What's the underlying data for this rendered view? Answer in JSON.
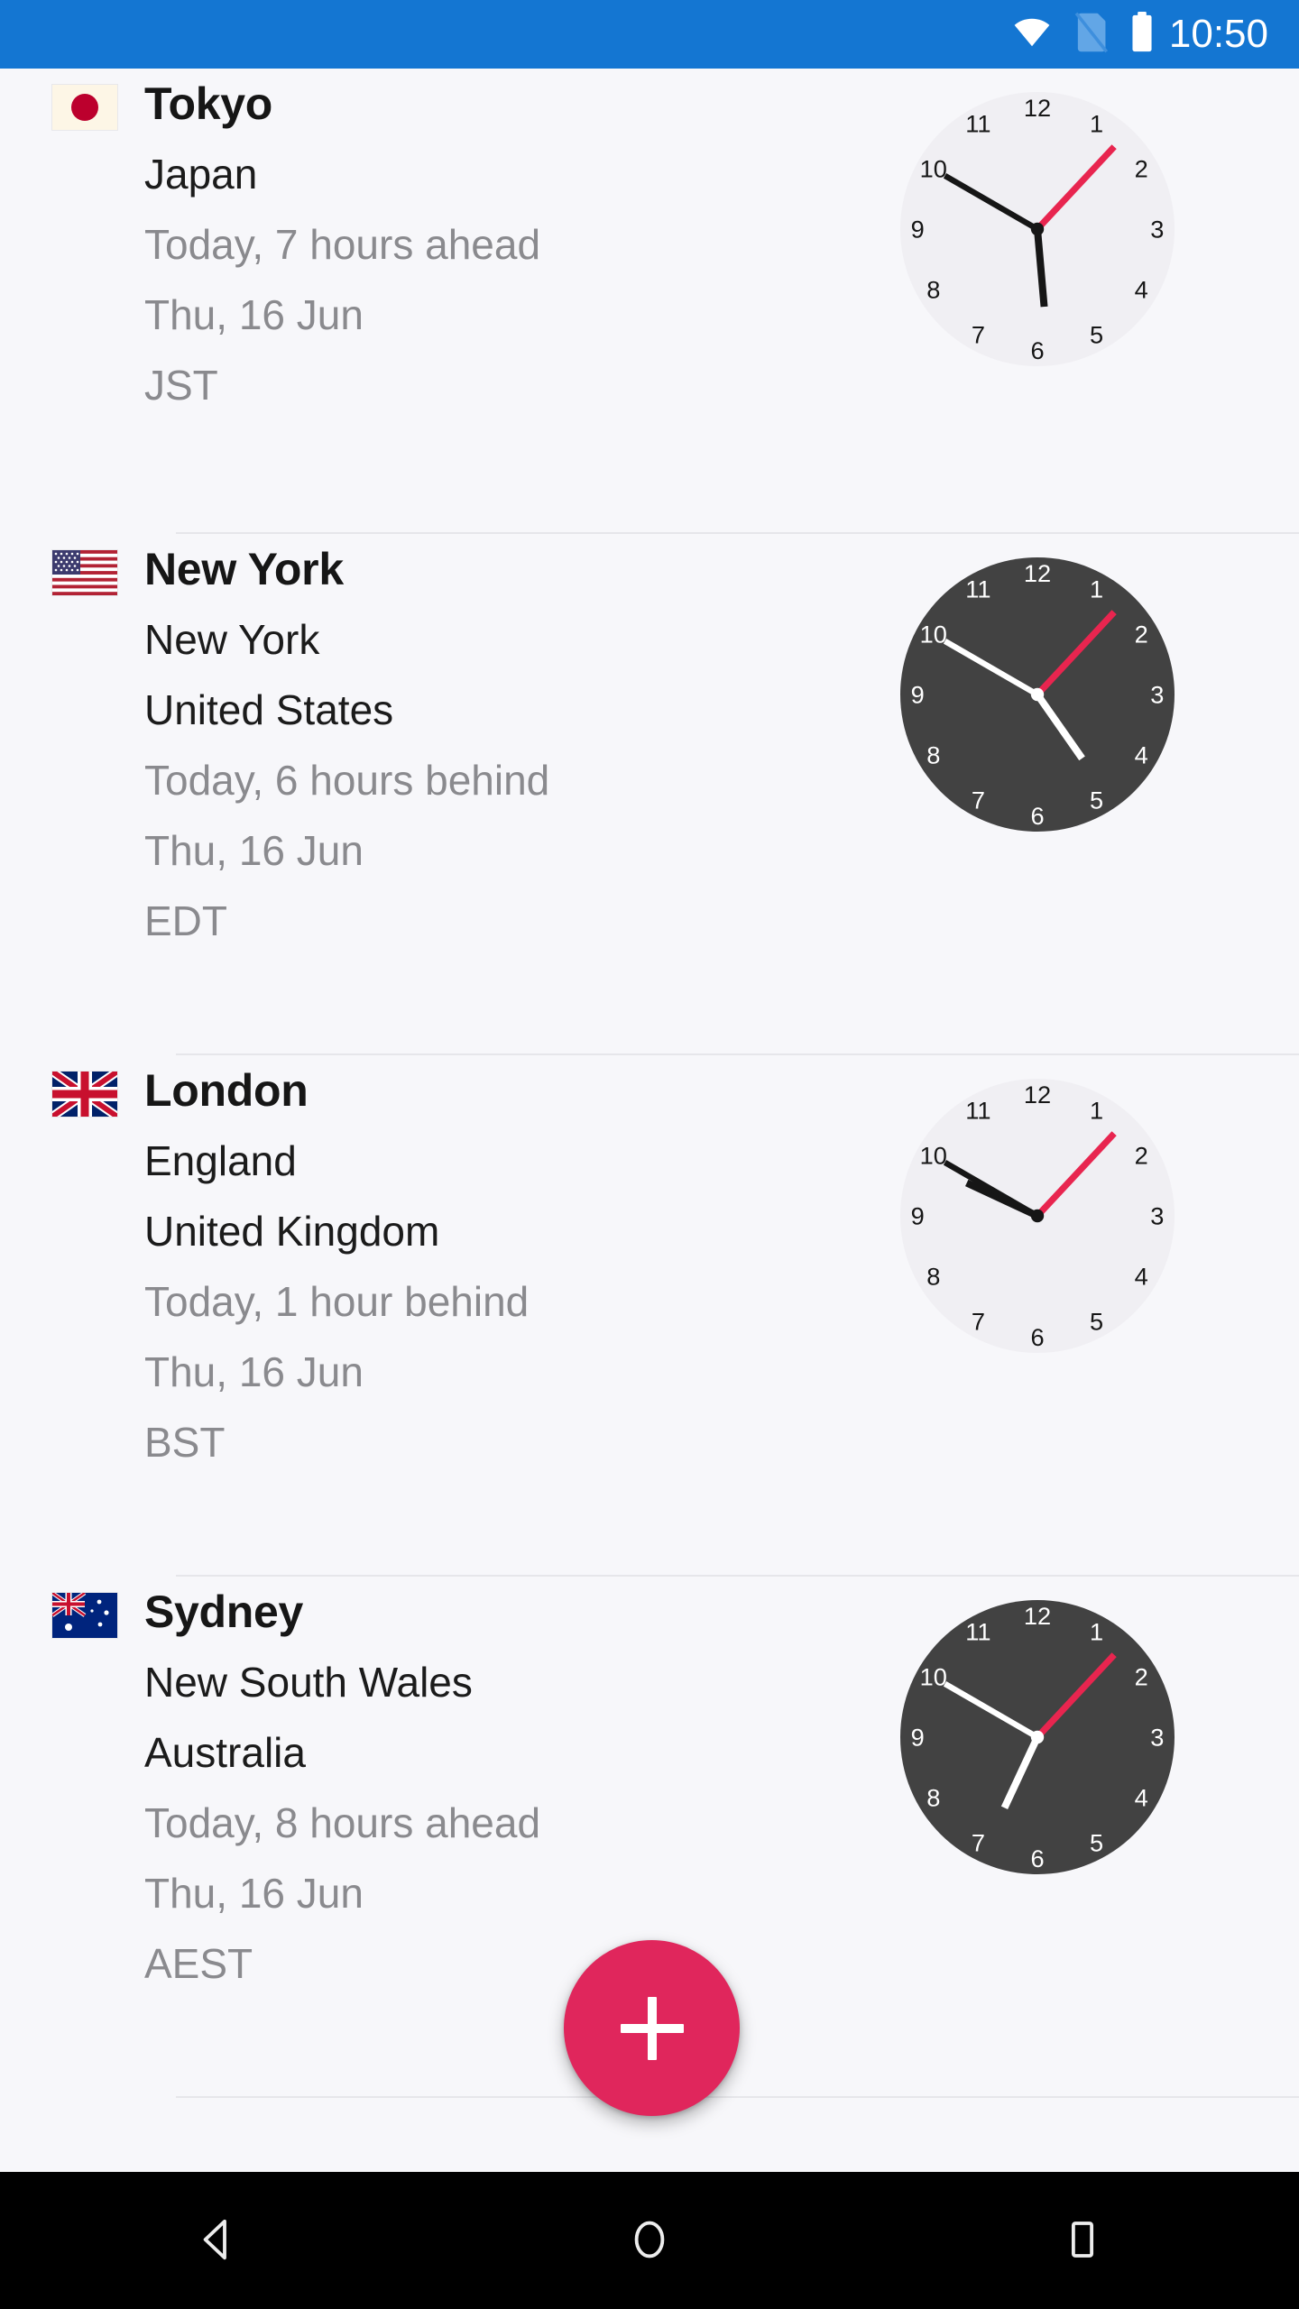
{
  "status_bar": {
    "background_color": "#1476D2",
    "time": "10:50",
    "icons": [
      {
        "name": "wifi-icon",
        "label": "wifi"
      },
      {
        "name": "no-sim-icon",
        "label": "no sim card"
      },
      {
        "name": "battery-icon",
        "label": "battery full"
      }
    ]
  },
  "theme": {
    "page_background": "#F7F7FA",
    "accent_color": "#E0265C",
    "primary_color": "#1476D2",
    "divider_color": "#E6E6EA",
    "light_clock_face": "#F0EFF3",
    "dark_clock_face": "#424242",
    "secondary_text": "#8A8A8E"
  },
  "cities": [
    {
      "name": "Tokyo",
      "region": "",
      "country": "Japan",
      "offset": "Today, 7 hours ahead",
      "date": "Thu, 16 Jun",
      "timezone_abbr": "JST",
      "flag": "japan-flag",
      "clock": {
        "theme": "light",
        "hour_angle": 175,
        "minute_angle": 300,
        "second_angle": 43,
        "time": "5:50"
      }
    },
    {
      "name": "New York",
      "region": "New York",
      "country": "United States",
      "offset": "Today, 6 hours behind",
      "date": "Thu, 16 Jun",
      "timezone_abbr": "EDT",
      "flag": "usa-flag",
      "clock": {
        "theme": "dark",
        "hour_angle": 145,
        "minute_angle": 300,
        "second_angle": 43,
        "time": "4:50"
      }
    },
    {
      "name": "London",
      "region": "England",
      "country": "United Kingdom",
      "offset": "Today, 1 hour behind",
      "date": "Thu, 16 Jun",
      "timezone_abbr": "BST",
      "flag": "uk-flag",
      "clock": {
        "theme": "light",
        "hour_angle": 295,
        "minute_angle": 300,
        "second_angle": 43,
        "time": "9:50"
      }
    },
    {
      "name": "Sydney",
      "region": "New South Wales",
      "country": "Australia",
      "offset": "Today, 8 hours ahead",
      "date": "Thu, 16 Jun",
      "timezone_abbr": "AEST",
      "flag": "australia-flag",
      "clock": {
        "theme": "dark",
        "hour_angle": 205,
        "minute_angle": 300,
        "second_angle": 43,
        "time": "6:50"
      }
    }
  ],
  "clock_numerals": [
    "12",
    "1",
    "2",
    "3",
    "4",
    "5",
    "6",
    "7",
    "8",
    "9",
    "10",
    "11"
  ],
  "fab": {
    "label": "+",
    "name": "add-city-button"
  },
  "nav_bar": {
    "buttons": [
      {
        "name": "nav-back-button",
        "label": "Back"
      },
      {
        "name": "nav-home-button",
        "label": "Home"
      },
      {
        "name": "nav-recents-button",
        "label": "Recents"
      }
    ]
  }
}
